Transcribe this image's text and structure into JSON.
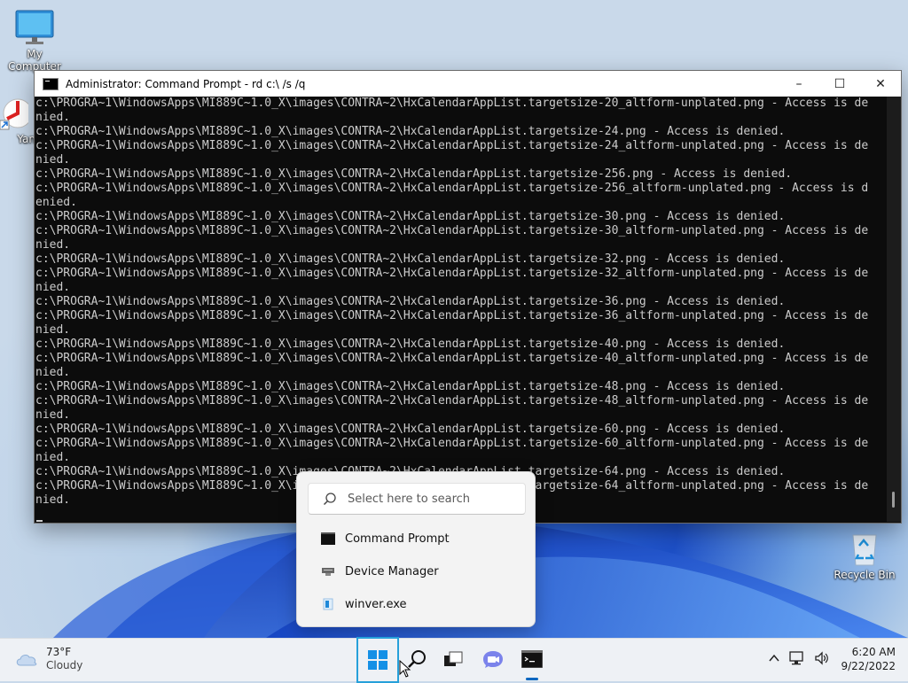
{
  "desktop": {
    "icons": [
      {
        "label": "My Computer",
        "icon": "monitor-icon"
      },
      {
        "label": "Yan",
        "icon": "shortcut-icon"
      },
      {
        "label": "Recycle Bin",
        "icon": "recycle-bin-icon"
      }
    ]
  },
  "window": {
    "title": "Administrator: Command Prompt - rd  c:\\ /s /q",
    "controls": {
      "minimize": "–",
      "maximize": "☐",
      "close": "✕"
    },
    "lines": [
      "c:\\PROGRA~1\\WindowsApps\\MI889C~1.0_X\\images\\CONTRA~2\\HxCalendarAppList.targetsize-20_altform-unplated.png - Access is de",
      "nied.",
      "c:\\PROGRA~1\\WindowsApps\\MI889C~1.0_X\\images\\CONTRA~2\\HxCalendarAppList.targetsize-24.png - Access is denied.",
      "c:\\PROGRA~1\\WindowsApps\\MI889C~1.0_X\\images\\CONTRA~2\\HxCalendarAppList.targetsize-24_altform-unplated.png - Access is de",
      "nied.",
      "c:\\PROGRA~1\\WindowsApps\\MI889C~1.0_X\\images\\CONTRA~2\\HxCalendarAppList.targetsize-256.png - Access is denied.",
      "c:\\PROGRA~1\\WindowsApps\\MI889C~1.0_X\\images\\CONTRA~2\\HxCalendarAppList.targetsize-256_altform-unplated.png - Access is d",
      "enied.",
      "c:\\PROGRA~1\\WindowsApps\\MI889C~1.0_X\\images\\CONTRA~2\\HxCalendarAppList.targetsize-30.png - Access is denied.",
      "c:\\PROGRA~1\\WindowsApps\\MI889C~1.0_X\\images\\CONTRA~2\\HxCalendarAppList.targetsize-30_altform-unplated.png - Access is de",
      "nied.",
      "c:\\PROGRA~1\\WindowsApps\\MI889C~1.0_X\\images\\CONTRA~2\\HxCalendarAppList.targetsize-32.png - Access is denied.",
      "c:\\PROGRA~1\\WindowsApps\\MI889C~1.0_X\\images\\CONTRA~2\\HxCalendarAppList.targetsize-32_altform-unplated.png - Access is de",
      "nied.",
      "c:\\PROGRA~1\\WindowsApps\\MI889C~1.0_X\\images\\CONTRA~2\\HxCalendarAppList.targetsize-36.png - Access is denied.",
      "c:\\PROGRA~1\\WindowsApps\\MI889C~1.0_X\\images\\CONTRA~2\\HxCalendarAppList.targetsize-36_altform-unplated.png - Access is de",
      "nied.",
      "c:\\PROGRA~1\\WindowsApps\\MI889C~1.0_X\\images\\CONTRA~2\\HxCalendarAppList.targetsize-40.png - Access is denied.",
      "c:\\PROGRA~1\\WindowsApps\\MI889C~1.0_X\\images\\CONTRA~2\\HxCalendarAppList.targetsize-40_altform-unplated.png - Access is de",
      "nied.",
      "c:\\PROGRA~1\\WindowsApps\\MI889C~1.0_X\\images\\CONTRA~2\\HxCalendarAppList.targetsize-48.png - Access is denied.",
      "c:\\PROGRA~1\\WindowsApps\\MI889C~1.0_X\\images\\CONTRA~2\\HxCalendarAppList.targetsize-48_altform-unplated.png - Access is de",
      "nied.",
      "c:\\PROGRA~1\\WindowsApps\\MI889C~1.0_X\\images\\CONTRA~2\\HxCalendarAppList.targetsize-60.png - Access is denied.",
      "c:\\PROGRA~1\\WindowsApps\\MI889C~1.0_X\\images\\CONTRA~2\\HxCalendarAppList.targetsize-60_altform-unplated.png - Access is de",
      "nied.",
      "c:\\PROGRA~1\\WindowsApps\\MI889C~1.0_X\\images\\CONTRA~2\\HxCalendarAppList.targetsize-64.png - Access is denied.",
      "c:\\PROGRA~1\\WindowsApps\\MI889C~1.0_X\\images\\CONTRA~2\\HxCalendarAppList.targetsize-64_altform-unplated.png - Access is de",
      "nied."
    ]
  },
  "search_popup": {
    "placeholder": "Select here to search",
    "results": [
      {
        "label": "Command Prompt",
        "icon": "command-prompt-icon"
      },
      {
        "label": "Device Manager",
        "icon": "device-manager-icon"
      },
      {
        "label": "winver.exe",
        "icon": "winver-icon"
      }
    ]
  },
  "taskbar": {
    "weather": {
      "temp": "73°F",
      "condition": "Cloudy",
      "icon": "cloud-icon"
    },
    "buttons": [
      "start-icon",
      "search-icon",
      "task-view-icon",
      "chat-icon",
      "command-prompt-icon"
    ],
    "tray": [
      "chevron-up-icon",
      "network-icon",
      "volume-icon"
    ],
    "clock": {
      "time": "6:20 AM",
      "date": "9/22/2022"
    }
  },
  "colors": {
    "accent": "#0067c0",
    "console_bg": "#0c0c0c",
    "console_fg": "#cccccc",
    "start_highlight": "#26a0da"
  }
}
